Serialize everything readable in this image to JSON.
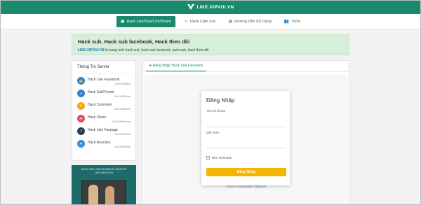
{
  "header": {
    "site_name": "LIKE.VIPVUI.VN"
  },
  "menu": [
    {
      "label": "Hack Like/Sub/Cmt/Share",
      "icon": "facebook-icon",
      "active": true
    },
    {
      "label": "Hack Cảm Xúc",
      "icon": "emoji-icon",
      "active": false
    },
    {
      "label": "Hướng Dẫn Sử Dụng",
      "icon": "book-icon",
      "active": false
    },
    {
      "label": "Tools",
      "icon": "users-icon",
      "active": false
    }
  ],
  "banner": {
    "title": "Hack sub, Hack sub facebook, Hack theo dõi",
    "brand": "LIKE.VIPVUI.VN",
    "text": " là trang web hack sub, hack sub facebook, auto sub, hack theo dõi"
  },
  "server": {
    "title": "Thông Tin Server",
    "items": [
      {
        "name": "Hack Like Facebook",
        "sub": "Giá 4000Đ/like",
        "color": "#2f82d0",
        "icon": "thumbs-up-icon"
      },
      {
        "name": "Hack Sub/Friend",
        "sub": "Giá 4000Đ/sub",
        "color": "#3a7fc9",
        "icon": "user-plus-icon"
      },
      {
        "name": "Hack Comment",
        "sub": "Giá 4000Đ/cmt",
        "color": "#f3a712",
        "icon": "comment-icon"
      },
      {
        "name": "Hack Share",
        "sub": "Giá 4000Đ/share",
        "color": "#e84a5f",
        "icon": "share-icon"
      },
      {
        "name": "Hack Like Fanpage",
        "sub": "Giá 4000Đ/like",
        "color": "#2c3e50",
        "icon": "flag-icon"
      },
      {
        "name": "Hack Reaction",
        "sub": "Giá 4000Đ/like",
        "color": "#3a8fd8",
        "icon": "heart-icon"
      }
    ]
  },
  "promo": {
    "text": "HACK LIKE, SUB FACEBOOK MIỄN PHÍ LIKE.VIPVUI.VN"
  },
  "tab": {
    "label": "Đăng Nhập Hack Sub Facebook"
  },
  "login": {
    "title": "Đăng Nhập",
    "username_label": "Tên tài khoản",
    "password_label": "Mật khẩu",
    "remember_label": "Nhớ tài khoản",
    "button_label": "Đăng Nhập",
    "signup_prompt": "Chưa có tài khoản?",
    "signup_link": "Đăng Kí"
  }
}
